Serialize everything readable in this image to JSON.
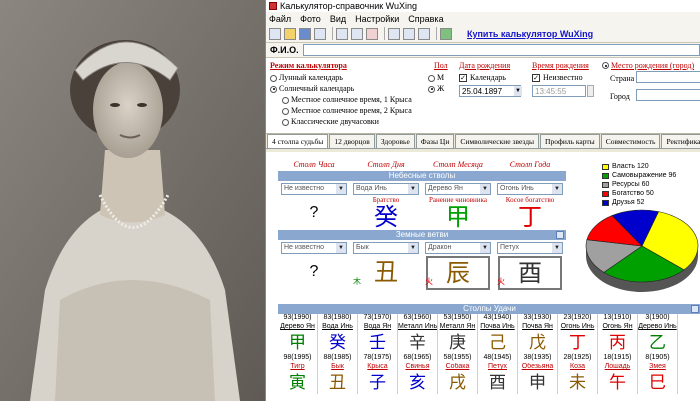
{
  "window": {
    "title": "Калькулятор-справочник WuXing"
  },
  "menu": [
    "Файл",
    "Фото",
    "Вид",
    "Настройки",
    "Справка"
  ],
  "toolbar": {
    "buy_link": "Купить калькулятор WuXing"
  },
  "fio": {
    "label": "Ф.И.О.",
    "value": ""
  },
  "settings": {
    "mode_title": "Режим калькулятора",
    "lunar": "Лунный календарь",
    "solar": "Солнечный календарь",
    "opt1": "Местное солнечное время, 1 Крыса",
    "opt2": "Местное солнечное время, 2 Крыса",
    "opt3": "Классические двучасовки",
    "sex_title": "Пол",
    "male": "М",
    "female": "Ж",
    "date_title": "Дата рождения",
    "calendar_label": "Календарь",
    "date_value": "25.04.1897",
    "time_title": "Время рождения",
    "unknown_label": "Неизвестно",
    "time_value": "13:45:55",
    "place_title": "Место рождения (город)",
    "country_label": "Страна",
    "city_label": "Город"
  },
  "tabs": [
    "4 столпа судьбы",
    "12 дворцов",
    "Здоровье",
    "Фазы Ци",
    "Символические звезды",
    "Профиль карты",
    "Совместимость",
    "Ректификация"
  ],
  "pillars": {
    "headers": [
      "Столп Часа",
      "Столп Дня",
      "Столп Месяца",
      "Столп Года"
    ],
    "stems_band": "Небесные стволы",
    "stems_selects": [
      "Не известно",
      "Вода Инь",
      "Дерево Ян",
      "Огонь Инь"
    ],
    "stems_labels": [
      "",
      "Братство",
      "Ранение чиновника",
      "Косое богатство"
    ],
    "stems_glyphs": [
      "?",
      "癸",
      "甲",
      "丁"
    ],
    "branches_band": "Земные ветви",
    "branches_selects": [
      "Не известно",
      "Бык",
      "Дракон",
      "Петух"
    ],
    "branch_glyphs": [
      "?",
      "丑",
      "辰",
      "酉"
    ],
    "branch_small": [
      "",
      "木",
      "火",
      "火"
    ]
  },
  "legend": [
    {
      "label": "Власть",
      "value": "120",
      "color": "#ffff00"
    },
    {
      "label": "Самовыражение",
      "value": "96",
      "color": "#00a000"
    },
    {
      "label": "Ресурсы",
      "value": "60",
      "color": "#a0a0a0"
    },
    {
      "label": "Богатство",
      "value": "50",
      "color": "#ff0000"
    },
    {
      "label": "Друзья",
      "value": "52",
      "color": "#0000cc"
    }
  ],
  "luck": {
    "band": "Столпы Удачи",
    "top_years": [
      "93(1990)",
      "83(1980)",
      "73(1970)",
      "63(1960)",
      "53(1950)",
      "43(1940)",
      "33(1930)",
      "23(1920)",
      "13(1910)",
      "3(1900)"
    ],
    "top_names": [
      "Дерево Ян",
      "Вода Инь",
      "Вода Ян",
      "Металл Инь",
      "Металл Ян",
      "Почва Инь",
      "Почва Ян",
      "Огонь Инь",
      "Огонь Ян",
      "Дерево Инь"
    ],
    "top_glyphs": [
      "甲",
      "癸",
      "壬",
      "辛",
      "庚",
      "己",
      "戊",
      "丁",
      "丙",
      "乙"
    ],
    "top_colors": [
      "#008000",
      "#0000cc",
      "#0000cc",
      "#333333",
      "#333333",
      "#8b5a00",
      "#8b5a00",
      "#e00000",
      "#e00000",
      "#008000"
    ],
    "bottom_years": [
      "98(1995)",
      "88(1985)",
      "78(1975)",
      "68(1965)",
      "58(1955)",
      "48(1945)",
      "38(1935)",
      "28(1925)",
      "18(1915)",
      "8(1905)"
    ],
    "animals": [
      "Тигр",
      "Бык",
      "Крыса",
      "Свинья",
      "Собака",
      "Петух",
      "Обезьяна",
      "Коза",
      "Лошадь",
      "Змея"
    ],
    "bottom_glyphs": [
      "寅",
      "丑",
      "子",
      "亥",
      "戌",
      "酉",
      "申",
      "未",
      "午",
      "巳"
    ],
    "bottom_colors": [
      "#008000",
      "#8b5a00",
      "#0000cc",
      "#0000cc",
      "#8b5a00",
      "#333333",
      "#333333",
      "#8b5a00",
      "#e00000",
      "#e00000"
    ]
  },
  "chart_data": {
    "type": "pie",
    "labels": [
      "Власть",
      "Самовыражение",
      "Ресурсы",
      "Богатство",
      "Друзья"
    ],
    "values": [
      120,
      96,
      60,
      50,
      52
    ],
    "colors": [
      "#ffff00",
      "#00a000",
      "#a0a0a0",
      "#ff0000",
      "#0000cc"
    ]
  }
}
